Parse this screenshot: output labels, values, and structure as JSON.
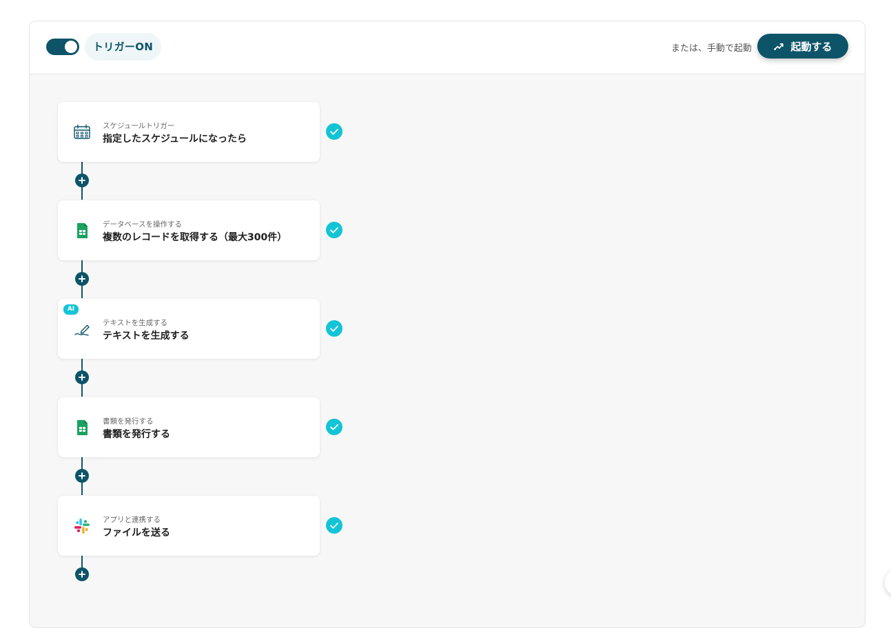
{
  "header": {
    "trigger_label": "トリガーON",
    "manual_text": "または、手動で起動",
    "start_button_label": "起動する",
    "colors": {
      "primary": "#0d5468",
      "accent": "#12c4d6",
      "canvas": "#f7f7f7"
    }
  },
  "flow": {
    "steps": [
      {
        "sub": "スケジュールトリガー",
        "title": "指定したスケジュールになったら",
        "icon": "calendar-icon",
        "status": "completed"
      },
      {
        "sub": "データベースを操作する",
        "title": "複数のレコードを取得する（最大300件）",
        "icon": "google-sheets-icon",
        "status": "completed"
      },
      {
        "sub": "テキストを生成する",
        "title": "テキストを生成する",
        "icon": "pen-icon",
        "badge": "AI",
        "status": "completed"
      },
      {
        "sub": "書類を発行する",
        "title": "書類を発行する",
        "icon": "google-sheets-icon",
        "status": "completed"
      },
      {
        "sub": "アプリと連携する",
        "title": "ファイルを送る",
        "icon": "slack-icon",
        "status": "completed"
      }
    ]
  }
}
